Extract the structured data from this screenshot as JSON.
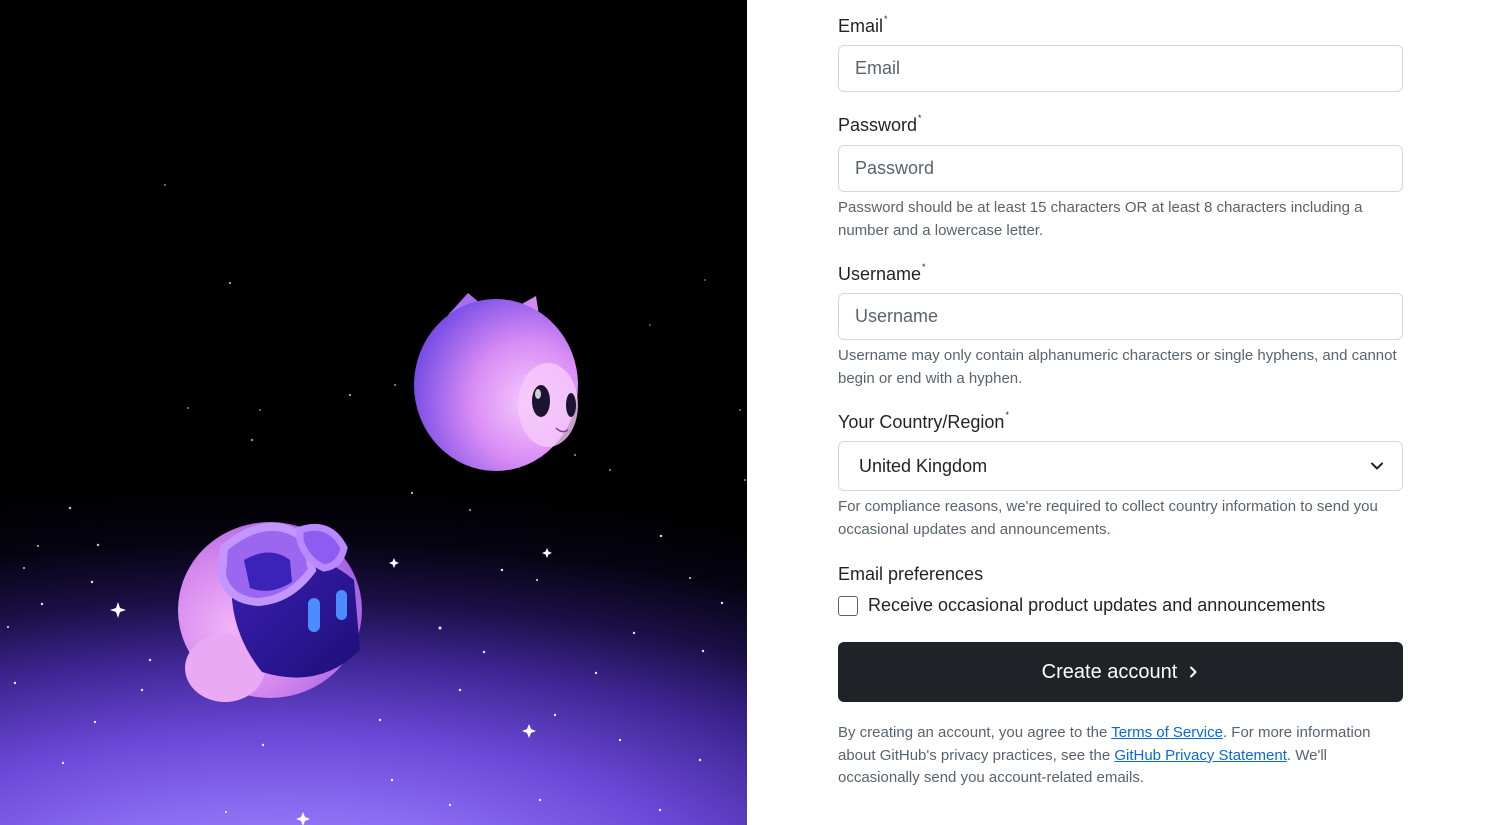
{
  "form": {
    "email": {
      "label": "Email",
      "required_mark": "*",
      "placeholder": "Email",
      "value": ""
    },
    "password": {
      "label": "Password",
      "required_mark": "*",
      "placeholder": "Password",
      "value": "",
      "hint": "Password should be at least 15 characters OR at least 8 characters including a number and a lowercase letter."
    },
    "username": {
      "label": "Username",
      "required_mark": "*",
      "placeholder": "Username",
      "value": "",
      "hint": "Username may only contain alphanumeric characters or single hyphens, and cannot begin or end with a hyphen."
    },
    "country": {
      "label": "Your Country/Region",
      "required_mark": "*",
      "selected": "United Kingdom",
      "hint": "For compliance reasons, we're required to collect country information to send you occasional updates and announcements."
    },
    "email_preferences": {
      "title": "Email preferences",
      "checkbox_label": "Receive occasional product updates and announcements",
      "checked": false
    },
    "submit_label": "Create account",
    "legal": {
      "text_1": "By creating an account, you agree to the ",
      "terms_link": "Terms of Service",
      "text_2": ". For more information about GitHub's privacy practices, see the ",
      "privacy_link": "GitHub Privacy Statement",
      "text_3": ". We'll occasionally send you account-related emails."
    }
  },
  "icons": {
    "select_chevron": "chevron-down-icon",
    "button_chevron": "chevron-right-icon"
  },
  "colors": {
    "button_bg": "#1f2328",
    "link": "#0969da",
    "muted_text": "#59636e",
    "border": "#d1d9e0"
  }
}
